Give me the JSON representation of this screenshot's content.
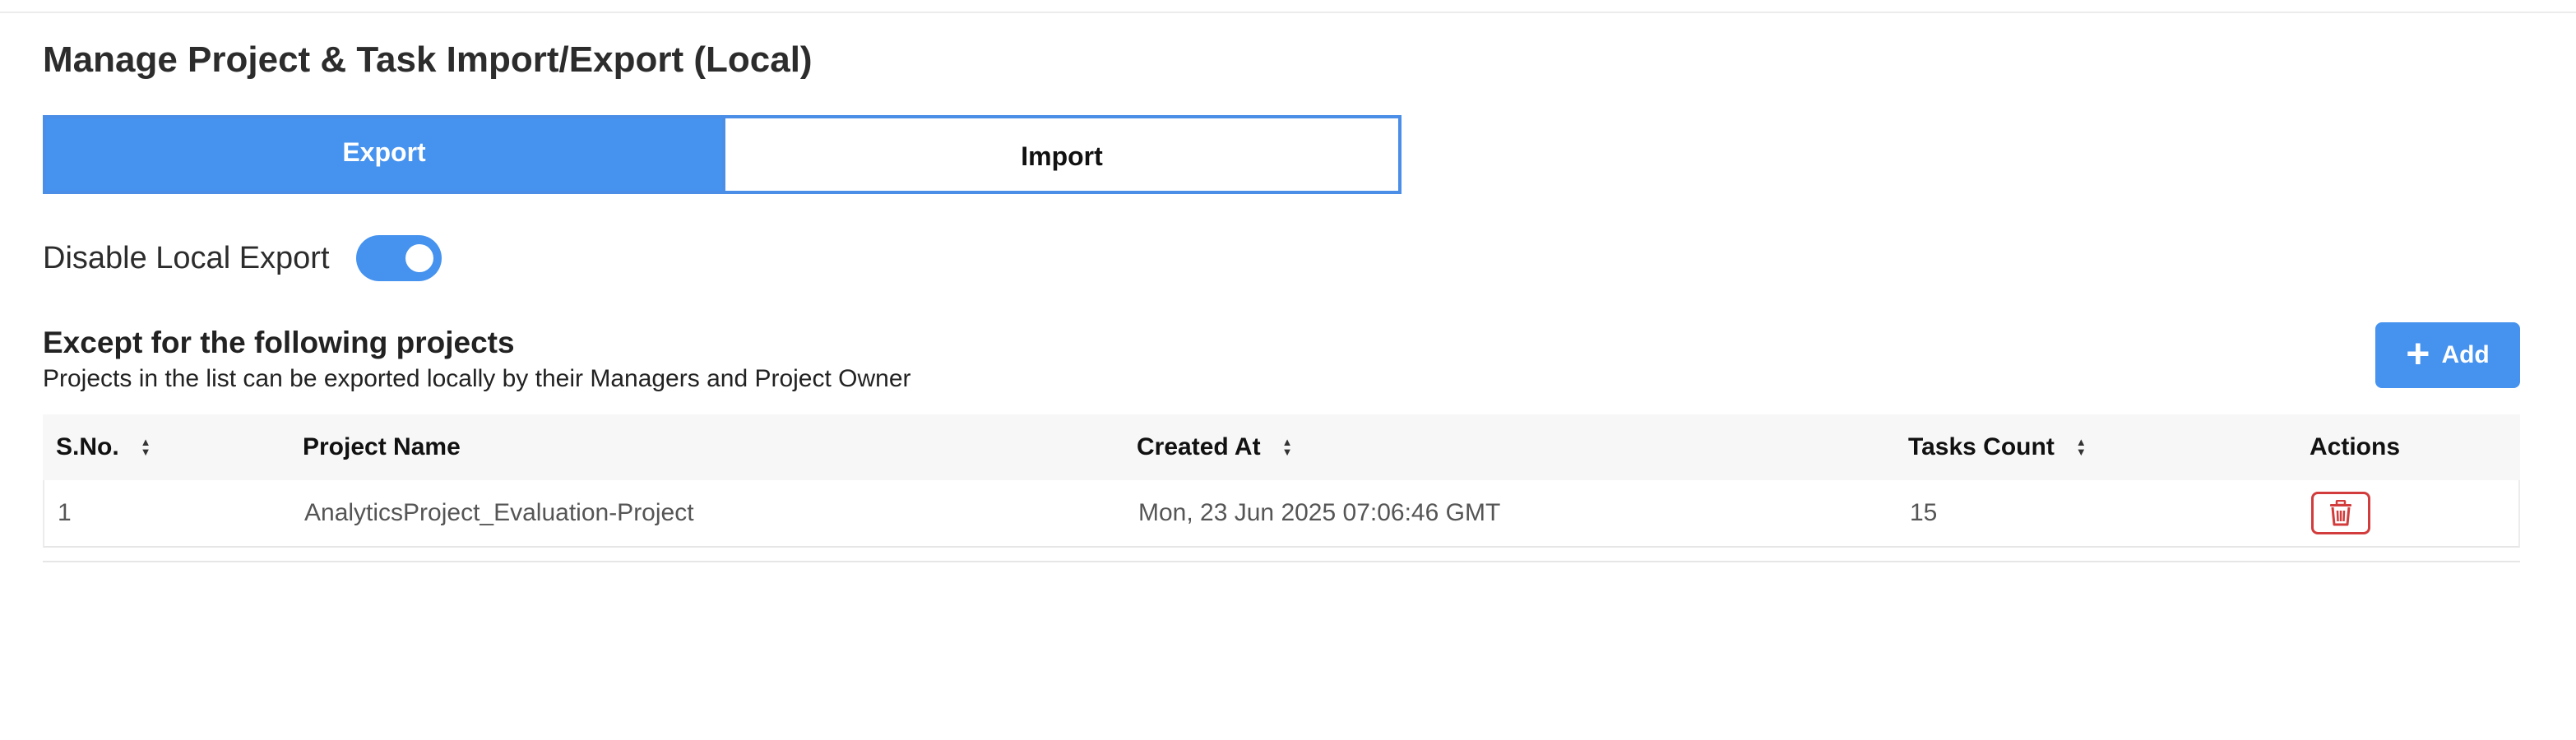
{
  "page": {
    "title": "Manage Project & Task Import/Export (Local)"
  },
  "tabs": [
    {
      "label": "Export",
      "active": true
    },
    {
      "label": "Import",
      "active": false
    }
  ],
  "toggle": {
    "label": "Disable Local Export",
    "checked": true
  },
  "section": {
    "title": "Except for the following projects",
    "subtitle": "Projects in the list can be exported locally by their Managers and Project Owner",
    "add_label": "Add"
  },
  "table": {
    "columns": [
      "S.No.",
      "Project Name",
      "Created At",
      "Tasks Count",
      "Actions"
    ],
    "rows": [
      {
        "sno": "1",
        "project_name": "AnalyticsProject_Evaluation-Project",
        "created_at": "Mon, 23 Jun 2025 07:06:46 GMT",
        "tasks_count": "15"
      }
    ]
  },
  "icons": {
    "sort": "sort-icon",
    "add": "plus-icon",
    "delete": "trash-icon"
  },
  "colors": {
    "primary": "#4592ef",
    "danger": "#d23c3c"
  }
}
